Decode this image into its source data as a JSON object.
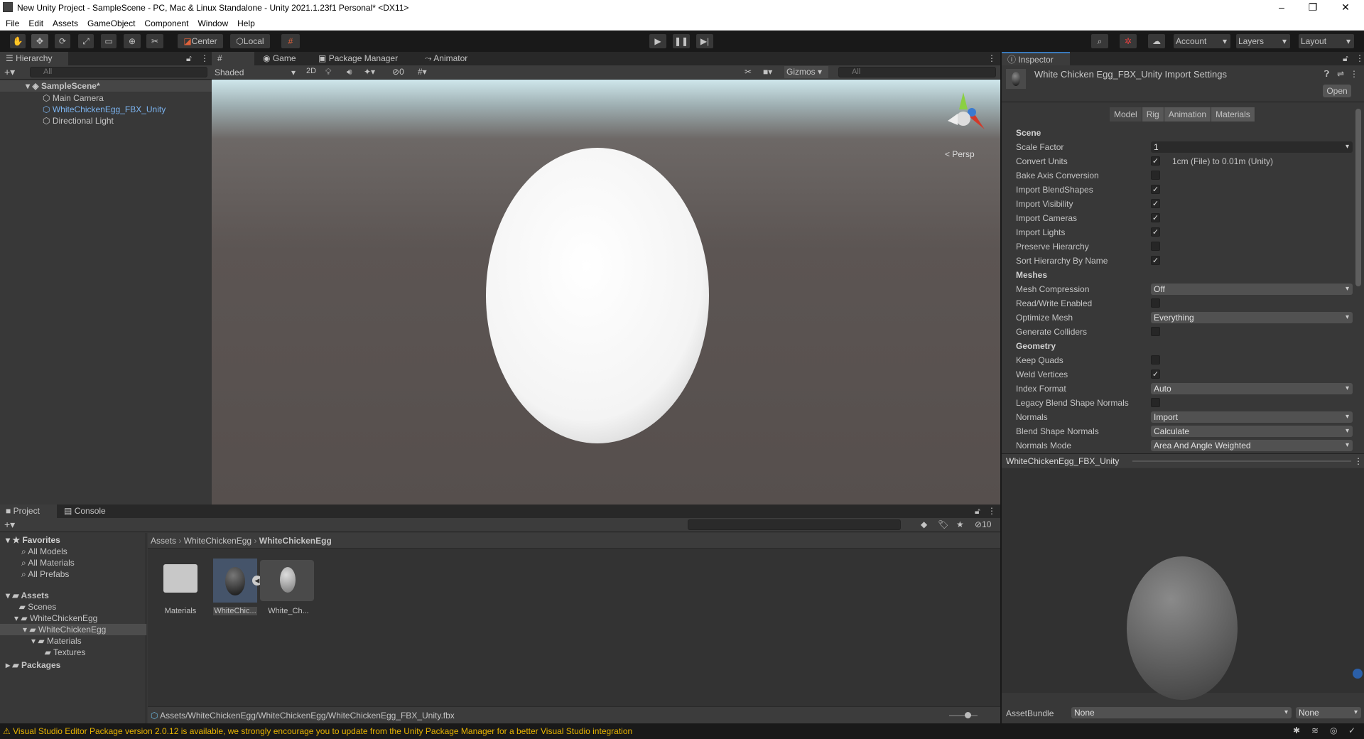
{
  "window": {
    "title": "New Unity Project - SampleScene - PC, Mac & Linux Standalone - Unity 2021.1.23f1 Personal* <DX11>",
    "minimize": "–",
    "maximize": "❐",
    "close": "✕"
  },
  "menu": [
    "File",
    "Edit",
    "Assets",
    "GameObject",
    "Component",
    "Window",
    "Help"
  ],
  "toolbar": {
    "center": "Center",
    "local": "Local",
    "account": "Account",
    "layers": "Layers",
    "layout": "Layout"
  },
  "hierarchy": {
    "tab": "Hierarchy",
    "search_placeholder": "All",
    "scene": "SampleScene*",
    "items": [
      {
        "label": "Main Camera",
        "selected": false
      },
      {
        "label": "WhiteChickenEgg_FBX_Unity",
        "selected": true
      },
      {
        "label": "Directional Light",
        "selected": false
      }
    ]
  },
  "scene_tabs": [
    {
      "label": "Scene",
      "icon": "grid-icon"
    },
    {
      "label": "Game",
      "icon": "gamepad-icon"
    },
    {
      "label": "Package Manager",
      "icon": "package-icon"
    },
    {
      "label": "Animator",
      "icon": "animator-icon"
    }
  ],
  "scene_toolbar": {
    "shading": "Shaded",
    "mode_2d": "2D",
    "hidden_count": "0",
    "gizmos": "Gizmos",
    "search_placeholder": "All",
    "persp": "< Persp"
  },
  "inspector": {
    "tab": "Inspector",
    "title": "White Chicken Egg_FBX_Unity Import Settings",
    "open": "Open",
    "tabs": [
      "Model",
      "Rig",
      "Animation",
      "Materials"
    ],
    "active_tab": "Model",
    "rows": [
      {
        "type": "header",
        "label": "Scene"
      },
      {
        "type": "text",
        "label": "Scale Factor",
        "value": "1"
      },
      {
        "type": "check",
        "label": "Convert Units",
        "checked": true,
        "note": "1cm (File) to 0.01m (Unity)"
      },
      {
        "type": "check",
        "label": "Bake Axis Conversion",
        "checked": false
      },
      {
        "type": "check",
        "label": "Import BlendShapes",
        "checked": true
      },
      {
        "type": "check",
        "label": "Import Visibility",
        "checked": true
      },
      {
        "type": "check",
        "label": "Import Cameras",
        "checked": true
      },
      {
        "type": "check",
        "label": "Import Lights",
        "checked": true
      },
      {
        "type": "check",
        "label": "Preserve Hierarchy",
        "checked": false
      },
      {
        "type": "check",
        "label": "Sort Hierarchy By Name",
        "checked": true
      },
      {
        "type": "header",
        "label": "Meshes"
      },
      {
        "type": "dropdown",
        "label": "Mesh Compression",
        "value": "Off"
      },
      {
        "type": "check",
        "label": "Read/Write Enabled",
        "checked": false
      },
      {
        "type": "dropdown",
        "label": "Optimize Mesh",
        "value": "Everything"
      },
      {
        "type": "check",
        "label": "Generate Colliders",
        "checked": false
      },
      {
        "type": "header",
        "label": "Geometry"
      },
      {
        "type": "check",
        "label": "Keep Quads",
        "checked": false
      },
      {
        "type": "check",
        "label": "Weld Vertices",
        "checked": true
      },
      {
        "type": "dropdown",
        "label": "Index Format",
        "value": "Auto"
      },
      {
        "type": "check",
        "label": "Legacy Blend Shape Normals",
        "checked": false
      },
      {
        "type": "dropdown",
        "label": "Normals",
        "value": "Import"
      },
      {
        "type": "dropdown",
        "label": "Blend Shape Normals",
        "value": "Calculate"
      },
      {
        "type": "dropdown",
        "label": "Normals Mode",
        "value": "Area And Angle Weighted"
      }
    ],
    "preview_title": "WhiteChickenEgg_FBX_Unity",
    "asset_bundle_label": "AssetBundle",
    "asset_bundle": "None",
    "asset_variant": "None"
  },
  "project": {
    "tabs": [
      "Project",
      "Console"
    ],
    "hidden_count": "10",
    "favorites": {
      "label": "Favorites",
      "items": [
        "All Models",
        "All Materials",
        "All Prefabs"
      ]
    },
    "tree": [
      {
        "label": "Assets",
        "depth": 0,
        "bold": true
      },
      {
        "label": "Scenes",
        "depth": 1
      },
      {
        "label": "WhiteChickenEgg",
        "depth": 1
      },
      {
        "label": "WhiteChickenEgg",
        "depth": 2,
        "selected": true
      },
      {
        "label": "Materials",
        "depth": 3
      },
      {
        "label": "Textures",
        "depth": 4
      },
      {
        "label": "Packages",
        "depth": 0,
        "bold": true
      }
    ],
    "breadcrumb": [
      "Assets",
      "WhiteChickenEgg",
      "WhiteChickenEgg"
    ],
    "assets": [
      {
        "label": "Materials",
        "kind": "folder"
      },
      {
        "label": "WhiteChic...",
        "kind": "model",
        "selected": true
      },
      {
        "label": "White_Ch...",
        "kind": "mesh"
      }
    ],
    "path": "Assets/WhiteChickenEgg/WhiteChickenEgg/WhiteChickenEgg_FBX_Unity.fbx"
  },
  "status": {
    "message": "Visual Studio Editor Package version 2.0.12 is available, we strongly encourage you to update from the Unity Package Manager for a better Visual Studio integration",
    "color": "#e8b400"
  }
}
